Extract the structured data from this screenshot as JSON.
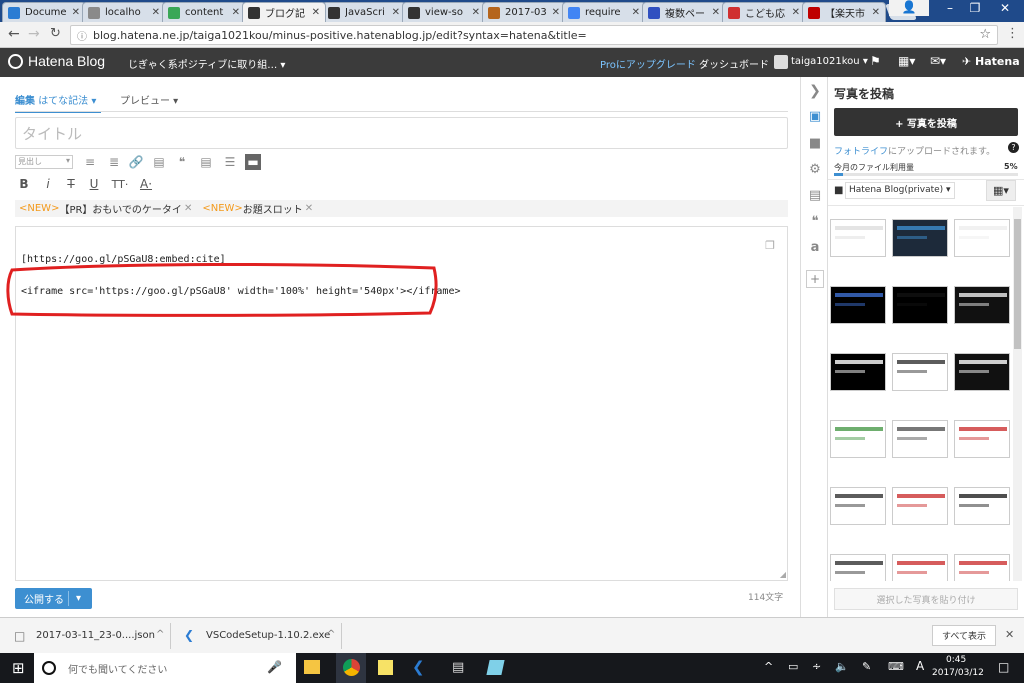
{
  "browser": {
    "tabs": [
      {
        "label": "Docume",
        "icon": "vscode-icon",
        "color": "#2b7cd3"
      },
      {
        "label": "localho",
        "icon": "page-icon",
        "color": "#8a8a8a"
      },
      {
        "label": "content",
        "icon": "at-icon",
        "color": "#3aa757"
      },
      {
        "label": "ブログ記",
        "icon": "hatena-icon",
        "color": "#333333"
      },
      {
        "label": "JavaScri",
        "icon": "hatena-icon",
        "color": "#333333"
      },
      {
        "label": "view-so",
        "icon": "hatena-icon",
        "color": "#333333"
      },
      {
        "label": "2017-03",
        "icon": "box-icon",
        "color": "#b5651d"
      },
      {
        "label": "require",
        "icon": "google-icon",
        "color": "#4285f4"
      },
      {
        "label": "複数ペー",
        "icon": "bookmark-icon",
        "color": "#3050c0"
      },
      {
        "label": "こども応",
        "icon": "flag-icon",
        "color": "#d03030"
      },
      {
        "label": "【楽天市",
        "icon": "rakuten-icon",
        "color": "#bf0000"
      }
    ],
    "url": "blog.hatena.ne.jp/taiga1021kou/minus-positive.hatenablog.jp/edit?syntax=hatena&title="
  },
  "header": {
    "logo": "Hatena Blog",
    "blog_name": "じぎゃく系ポジティブに取り組…",
    "pro_prefix": "Pro",
    "pro_suffix": "にアップグレード",
    "dashboard": "ダッシュボード",
    "user": "taiga1021kou",
    "brand": "Hatena"
  },
  "editor": {
    "tab_edit": "編集",
    "tab_edit_mode": "はてな記法",
    "tab_preview": "プレビュー",
    "title_placeholder": "タイトル",
    "heading_select": "見出し",
    "notice1_tag": "<NEW>",
    "notice1_text": "【PR】おもいでのケータイ",
    "notice2_tag": "<NEW>",
    "notice2_text": "お題スロット",
    "line1": "[https://goo.gl/pSGaU8:embed:cite]",
    "line2": "<iframe src='https://goo.gl/pSGaU8' width='100%' height='540px'></iframe>",
    "char_count": "114文字",
    "publish": "公開する",
    "highlight_color": "#e02020"
  },
  "panel": {
    "title": "写真を投稿",
    "upload_button": "+ 写真を投稿",
    "fotolife_link": "フォトライフ",
    "fotolife_text": "にアップロードされます。",
    "usage_label": "今月のファイル利用量",
    "usage_percent": "5%",
    "usage_value": 0.05,
    "folder": "Hatena Blog(private)",
    "paste_button": "選択した写真を貼り付け"
  },
  "downloads": {
    "items": [
      "2017-03-11_23-0....json",
      "VSCodeSetup-1.10.2.exe"
    ],
    "show_all": "すべて表示"
  },
  "taskbar": {
    "search": "何でも聞いてください",
    "ime": "A",
    "time": "0:45",
    "date": "2017/03/12"
  }
}
